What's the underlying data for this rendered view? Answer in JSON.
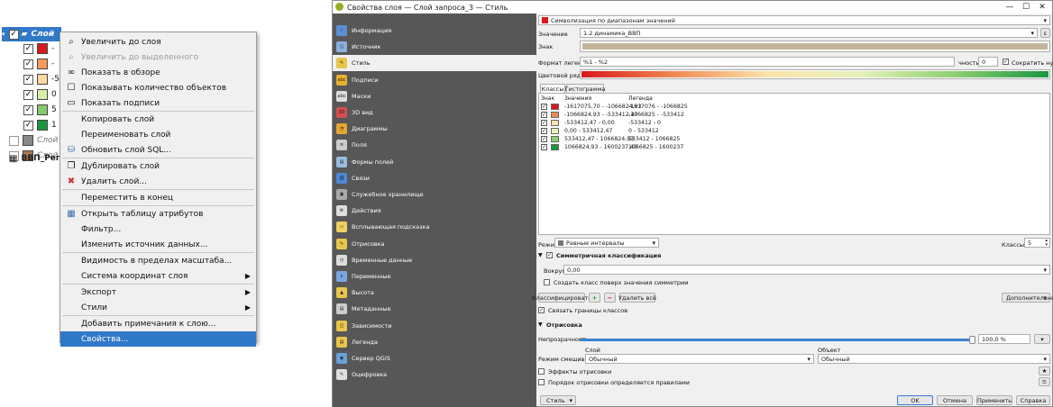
{
  "layers": {
    "group_name": "Слой",
    "items": [
      {
        "color": "#d7191c",
        "label": "-",
        "checked": true
      },
      {
        "color": "#f39c5c",
        "label": "-",
        "checked": true
      },
      {
        "color": "#fcd9a0",
        "label": "-5",
        "checked": true
      },
      {
        "color": "#d7eea8",
        "label": "0",
        "checked": true
      },
      {
        "color": "#86cb6e",
        "label": "5",
        "checked": true
      },
      {
        "color": "#1a9641",
        "label": "1",
        "checked": true
      }
    ],
    "other": [
      {
        "color": "#888888",
        "label": "Слой",
        "checked": false
      },
      {
        "color": "#a87856",
        "label": "Слой",
        "checked": false
      }
    ],
    "table_layer": "ВВП_Рег"
  },
  "context_menu": {
    "items": [
      {
        "label": "Увеличить до слоя",
        "icon": "zoom-layer-icon",
        "disabled": false
      },
      {
        "label": "Увеличить до выделенного",
        "icon": "zoom-selection-icon",
        "disabled": true
      },
      {
        "label": "Показать в обзоре",
        "icon": "overview-icon",
        "disabled": false
      },
      {
        "label": "Показывать количество объектов",
        "icon": "checkbox-icon",
        "disabled": false
      },
      {
        "label": "Показать подписи",
        "icon": "labels-icon",
        "disabled": false
      },
      {
        "label": "Копировать слой",
        "icon": "",
        "disabled": false
      },
      {
        "label": "Переименовать слой",
        "icon": "",
        "disabled": false
      },
      {
        "label": "Обновить слой SQL...",
        "icon": "database-icon",
        "disabled": false
      },
      {
        "label": "Дублировать слой",
        "icon": "duplicate-icon",
        "disabled": false
      },
      {
        "label": "Удалить слой...",
        "icon": "remove-layer-icon",
        "disabled": false
      },
      {
        "label": "Переместить в конец",
        "icon": "",
        "disabled": false
      },
      {
        "label": "Открыть таблицу атрибутов",
        "icon": "table-icon",
        "disabled": false
      },
      {
        "label": "Фильтр...",
        "icon": "",
        "disabled": false
      },
      {
        "label": "Изменить источник данных...",
        "icon": "",
        "disabled": false
      },
      {
        "label": "Видимость в пределах масштаба...",
        "icon": "",
        "disabled": false
      },
      {
        "label": "Система координат слоя",
        "icon": "",
        "disabled": false,
        "submenu": true
      },
      {
        "label": "Экспорт",
        "icon": "",
        "disabled": false,
        "submenu": true
      },
      {
        "label": "Стили",
        "icon": "",
        "disabled": false,
        "submenu": true
      },
      {
        "label": "Добавить примечания к слою...",
        "icon": "",
        "disabled": false
      },
      {
        "label": "Свойства...",
        "icon": "",
        "disabled": false,
        "selected": true
      }
    ]
  },
  "dialog": {
    "title": "Свойства слоя — Слой запроса_3 — Стиль",
    "nav": [
      {
        "label": "Информация",
        "icon": "info-icon",
        "color": "#5b8fd6"
      },
      {
        "label": "Источник",
        "icon": "source-icon",
        "color": "#8cb0de"
      },
      {
        "label": "Стиль",
        "icon": "style-icon",
        "color": "#e8c64a"
      },
      {
        "label": "Подписи",
        "icon": "labels-icon",
        "color": "#e8b030"
      },
      {
        "label": "Маски",
        "icon": "masks-icon",
        "color": "#dddddd"
      },
      {
        "label": "3D вид",
        "icon": "3d-icon",
        "color": "#d45050"
      },
      {
        "label": "Диаграммы",
        "icon": "diagrams-icon",
        "color": "#e7a630"
      },
      {
        "label": "Поля",
        "icon": "fields-icon",
        "color": "#cccccc"
      },
      {
        "label": "Формы полей",
        "icon": "forms-icon",
        "color": "#9bbbe0"
      },
      {
        "label": "Связи",
        "icon": "joins-icon",
        "color": "#4a8ad6"
      },
      {
        "label": "Служебное хранилище",
        "icon": "storage-icon",
        "color": "#aaaaaa"
      },
      {
        "label": "Действия",
        "icon": "actions-icon",
        "color": "#dddddd"
      },
      {
        "label": "Всплывающая подсказка",
        "icon": "tooltip-icon",
        "color": "#f0d060"
      },
      {
        "label": "Отрисовка",
        "icon": "rendering-icon",
        "color": "#e8c64a"
      },
      {
        "label": "Временные данные",
        "icon": "clock-icon",
        "color": "#dddddd"
      },
      {
        "label": "Переменные",
        "icon": "variables-icon",
        "color": "#7aa6de"
      },
      {
        "label": "Высота",
        "icon": "elevation-icon",
        "color": "#e8c64a"
      },
      {
        "label": "Метаданные",
        "icon": "metadata-icon",
        "color": "#cccccc"
      },
      {
        "label": "Зависимости",
        "icon": "dependencies-icon",
        "color": "#e8c64a"
      },
      {
        "label": "Легенда",
        "icon": "legend-icon",
        "color": "#e8c64a"
      },
      {
        "label": "Сервер QGIS",
        "icon": "server-icon",
        "color": "#6aa0d8"
      },
      {
        "label": "Оцифровка",
        "icon": "digitizing-icon",
        "color": "#dddddd"
      }
    ],
    "renderer": "Символизация по диапазонам значений",
    "value_label": "Значение",
    "value": "1.2 динамика_ВВП",
    "symbol_label": "Знак",
    "symbol_color": "#c2b59b",
    "legend_format_label": "Формат легенды",
    "legend_format": "%1 - %2",
    "precision_label": "чность",
    "precision_value": "0",
    "trim_zeros": "Сократить нули",
    "ramp_label": "Цветовой ряд",
    "tabs": [
      "Классы",
      "Гистограмма"
    ],
    "table_headers": [
      "Знак",
      "Значения",
      "Легенда"
    ],
    "classes": [
      {
        "color": "#d7191c",
        "value": "-1617075,70 - -1066824,93",
        "legend": "-1617076 - -1066825"
      },
      {
        "color": "#ef8a52",
        "value": "-1066824,93 - -533412,47",
        "legend": "-1066825 - -533412"
      },
      {
        "color": "#fde3ad",
        "value": "-533412,47 - 0,00",
        "legend": "-533412 - 0"
      },
      {
        "color": "#e4f2b8",
        "value": "0,00 - 533412,47",
        "legend": "0 - 533412"
      },
      {
        "color": "#8ccf70",
        "value": "533412,47 - 1066824,93",
        "legend": "533412 - 1066825"
      },
      {
        "color": "#1a9641",
        "value": "1066824,93 - 1600237,40",
        "legend": "1066825 - 1600237"
      }
    ],
    "mode_label": "Режим",
    "mode": "Равные интервалы",
    "classes_label": "Классы",
    "classes_count": "5",
    "symmetric_label": "Симметричная классификация",
    "around_label": "Вокруг",
    "around_value": "0,00",
    "symmetric_create": "Создать класс поверх значения симметрии",
    "classify_button": "Классифицировать",
    "delete_all_button": "Удалить всё",
    "advanced_button": "Дополнительно",
    "link_boundaries": "Связать границы классов",
    "rendering_label": "Отрисовка",
    "opacity_label": "Непрозрачность",
    "opacity_value": "100,0 %",
    "opacity_fraction": 1.0,
    "layer_col": "Слой",
    "object_col": "Объект",
    "blend_label": "Режим смешивания",
    "blend_layer": "Обычный",
    "blend_object": "Обычный",
    "effects_label": "Эффекты отрисовки",
    "order_label": "Порядок отрисовки определяется правилами",
    "style_button": "Стиль",
    "ok": "OK",
    "cancel": "Отмена",
    "apply": "Применить",
    "help": "Справка"
  }
}
